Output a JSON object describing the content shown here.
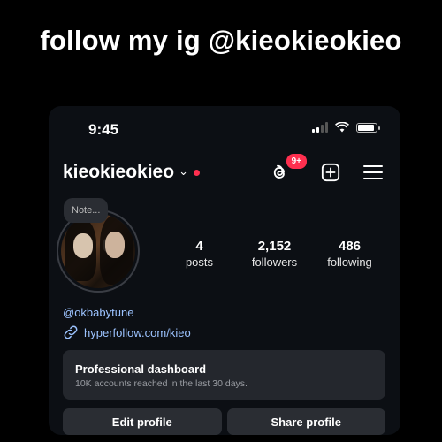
{
  "overlay": {
    "headline": "follow my ig @kieokieokieo"
  },
  "status_bar": {
    "time": "9:45"
  },
  "header": {
    "username": "kieokieokieo",
    "chevron": "⌄",
    "threads_badge": "9+",
    "icons": [
      "threads-icon",
      "add-icon",
      "menu-icon"
    ]
  },
  "note": {
    "text": "Note..."
  },
  "stats": [
    {
      "value": "4",
      "label": "posts"
    },
    {
      "value": "2,152",
      "label": "followers"
    },
    {
      "value": "486",
      "label": "following"
    }
  ],
  "bio": {
    "mention": "@okbabytune",
    "link": "hyperfollow.com/kieo"
  },
  "dashboard": {
    "title": "Professional dashboard",
    "subtitle": "10K accounts reached in the last 30 days."
  },
  "buttons": {
    "edit": "Edit profile",
    "share": "Share profile"
  },
  "colors": {
    "badge": "#ff2f4f",
    "link": "#9cc3ff",
    "panel": "#24272d"
  }
}
